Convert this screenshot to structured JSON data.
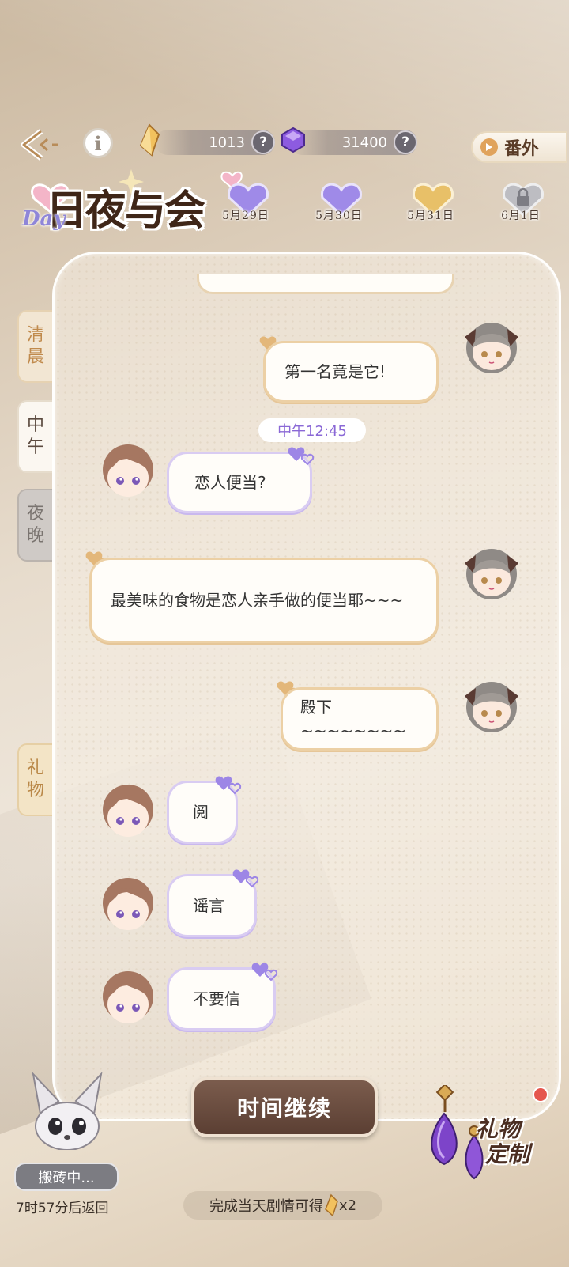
{
  "resources": {
    "gold_value": "1013",
    "purple_value": "31400",
    "help_glyph": "?"
  },
  "header": {
    "extra_label": "番外",
    "logo_title": "日夜与会",
    "logo_day": "Day"
  },
  "dates": [
    {
      "label": "5月29日",
      "state": "purple"
    },
    {
      "label": "5月30日",
      "state": "purple"
    },
    {
      "label": "5月31日",
      "state": "gold"
    },
    {
      "label": "6月1日",
      "state": "locked"
    }
  ],
  "side_tabs": {
    "dawn": [
      "清",
      "晨"
    ],
    "noon": [
      "中",
      "午"
    ],
    "night": [
      "夜",
      "晚"
    ],
    "gift": [
      "礼",
      "物"
    ]
  },
  "chat": {
    "time_marker": "中午12:45",
    "messages": [
      {
        "from": "self",
        "text": "第一名竟是它!"
      },
      {
        "from": "other",
        "text": "恋人便当?"
      },
      {
        "from": "self",
        "text": "最美味的食物是恋人亲手做的便当耶~~~"
      },
      {
        "from": "self",
        "text": "殿下~~~~~~~~"
      },
      {
        "from": "other",
        "text": "阅"
      },
      {
        "from": "other",
        "text": "谣言"
      },
      {
        "from": "other",
        "text": "不要信"
      }
    ]
  },
  "bottom": {
    "continue_label": "时间继续",
    "reward_text": "完成当天剧情可得",
    "reward_count": "x2",
    "pet_status": "搬砖中...",
    "pet_timer": "7时57分后返回",
    "gift_custom_line1": "礼物",
    "gift_custom_line2": "定制"
  },
  "colors": {
    "self_bubble_border": "#ecd0a5",
    "other_bubble_border": "#d9ccf2",
    "time_marker_text": "#8a68d6",
    "continue_button": "#6a4c3f",
    "notification_dot": "#e5564d"
  },
  "icons": [
    "back-icon",
    "info-icon",
    "gold-crystal-icon",
    "purple-gem-icon",
    "play-icon",
    "heart-icon",
    "lock-icon",
    "fennec-pet-icon",
    "earring-gift-icon"
  ]
}
